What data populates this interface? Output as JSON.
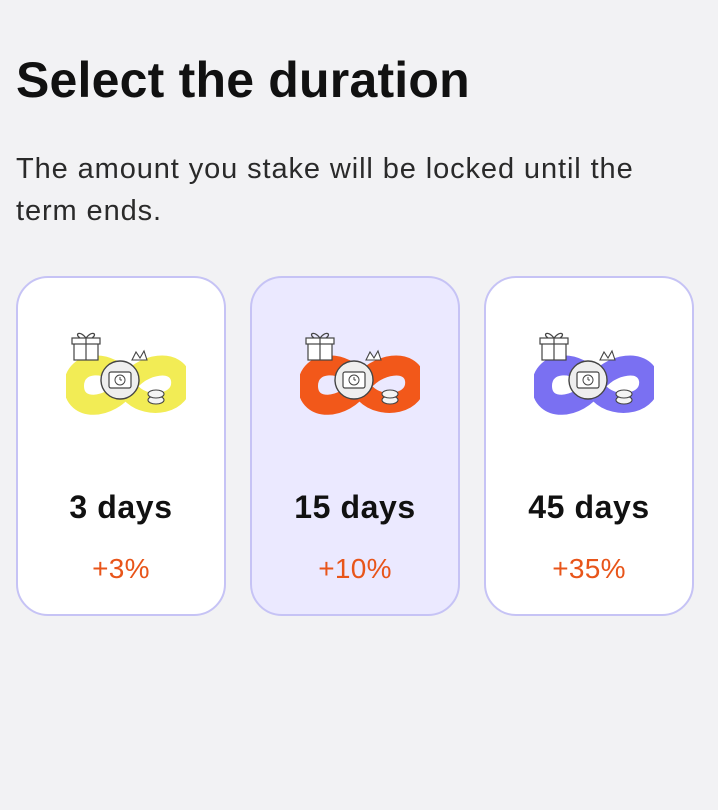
{
  "header": {
    "title": "Select the duration",
    "subtitle": "The amount you stake will be locked until the term ends."
  },
  "options": [
    {
      "days_label": "3 days",
      "rate_label": "+3%",
      "selected": false,
      "accent_color": "#f2ec55",
      "icon": "staking-infinity-illustration-icon"
    },
    {
      "days_label": "15 days",
      "rate_label": "+10%",
      "selected": true,
      "accent_color": "#f2581a",
      "icon": "staking-infinity-illustration-icon"
    },
    {
      "days_label": "45 days",
      "rate_label": "+35%",
      "selected": false,
      "accent_color": "#7a70f2",
      "icon": "staking-infinity-illustration-icon"
    }
  ],
  "colors": {
    "background": "#f2f2f4",
    "card_border": "#c6c3f5",
    "card_selected_bg": "#ebe9ff",
    "rate_text": "#e8551a"
  }
}
